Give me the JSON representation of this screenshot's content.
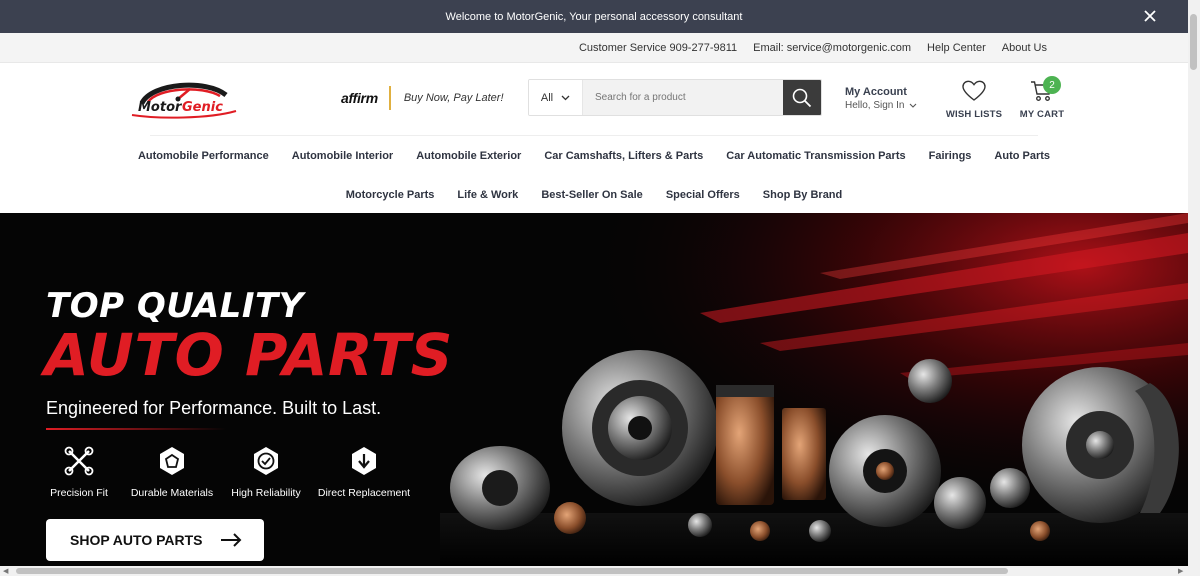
{
  "announcement": {
    "text": "Welcome to MotorGenic, Your personal accessory consultant"
  },
  "utility": {
    "customer_service": "Customer Service 909-277-9811",
    "email": "Email: service@motorgenic.com",
    "help": "Help Center",
    "about": "About Us"
  },
  "brand": {
    "name": "MotorGenic",
    "accent": "#e01d24"
  },
  "affirm": {
    "logo": "affirm",
    "text": "Buy Now, Pay Later!"
  },
  "search": {
    "category": "All",
    "placeholder": "Search for a product"
  },
  "account": {
    "title": "My Account",
    "subtitle": "Hello, Sign In"
  },
  "wishlist": {
    "label": "WISH LISTS"
  },
  "cart": {
    "label": "MY CART",
    "count": "2"
  },
  "nav": {
    "row1": [
      "Automobile Performance",
      "Automobile Interior",
      "Automobile Exterior",
      "Car Camshafts, Lifters & Parts",
      "Car Automatic Transmission Parts",
      "Fairings",
      "Auto Parts"
    ],
    "row2": [
      "Motorcycle Parts",
      "Life & Work",
      "Best-Seller On Sale",
      "Special Offers",
      "Shop By Brand"
    ]
  },
  "hero": {
    "line1": "TOP QUALITY",
    "line2": "AUTO PARTS",
    "tagline": "Engineered for Performance. Built to Last.",
    "features": [
      {
        "label": "Precision Fit",
        "icon": "wrench-cross-icon"
      },
      {
        "label": "Durable Materials",
        "icon": "shield-gear-icon"
      },
      {
        "label": "High Reliability",
        "icon": "check-shield-icon"
      },
      {
        "label": "Direct Replacement",
        "icon": "swap-icon"
      }
    ],
    "cta": "SHOP AUTO PARTS"
  }
}
